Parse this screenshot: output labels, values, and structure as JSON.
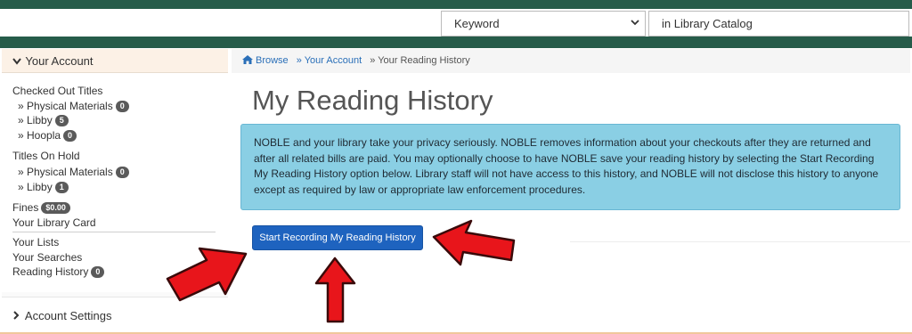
{
  "search": {
    "type_selected": "Keyword",
    "scope_selected": "in Library Catalog"
  },
  "sidebar": {
    "account_header": "Your Account",
    "checked_out_title": "Checked Out Titles",
    "checked_out_items": [
      {
        "label": "» Physical Materials",
        "count": "0"
      },
      {
        "label": "» Libby",
        "count": "5"
      },
      {
        "label": "» Hoopla",
        "count": "0"
      }
    ],
    "on_hold_title": "Titles On Hold",
    "on_hold_items": [
      {
        "label": "» Physical Materials",
        "count": "0"
      },
      {
        "label": "» Libby",
        "count": "1"
      }
    ],
    "fines_label": "Fines",
    "fines_amount": "$0.00",
    "library_card": "Your Library Card",
    "your_lists": "Your Lists",
    "your_searches": "Your Searches",
    "reading_history": "Reading History",
    "reading_history_count": "0",
    "account_settings": "Account Settings"
  },
  "breadcrumb": {
    "browse": "Browse",
    "your_account": "» Your Account",
    "current": "» Your Reading History"
  },
  "main": {
    "page_title": "My Reading History",
    "privacy_note": "NOBLE and your library take your privacy seriously. NOBLE removes information about your checkouts after they are returned and after all related bills are paid. You may optionally choose to have NOBLE save your reading history by selecting the Start Recording My Reading History option below. Library staff will not have access to this history, and NOBLE will not disclose this history to anyone except as required by law or appropriate law enforcement procedures.",
    "start_button": "Start Recording My Reading History"
  },
  "colors": {
    "header_green": "#265c4a",
    "notice_blue": "#8acfe4",
    "button_blue": "#1e63bf",
    "arrow_red": "#e8151b"
  },
  "icons": {
    "home": "home-icon",
    "chevron_down": "chevron-down-icon",
    "chevron_right": "chevron-right-icon",
    "annotation_arrows": "red-arrow-icon"
  }
}
